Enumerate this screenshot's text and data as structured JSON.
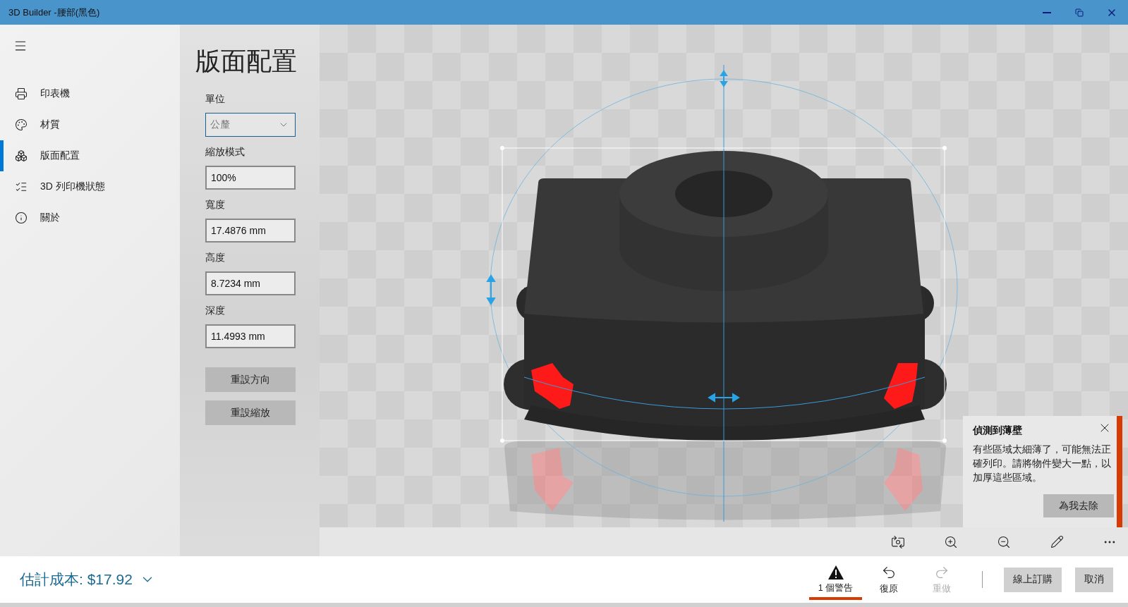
{
  "window": {
    "title": "3D Builder -腰部(黑色)"
  },
  "sidebar": {
    "items": [
      {
        "label": "印表機",
        "selected": false
      },
      {
        "label": "材質",
        "selected": false
      },
      {
        "label": "版面配置",
        "selected": true
      },
      {
        "label": "3D 列印機狀態",
        "selected": false
      },
      {
        "label": "關於",
        "selected": false
      }
    ]
  },
  "panel": {
    "title": "版面配置",
    "fields": [
      {
        "kind": "dropdown",
        "label": "單位",
        "value": "公釐"
      },
      {
        "kind": "input",
        "label": "縮放模式",
        "value": "100%"
      },
      {
        "kind": "input",
        "label": "寬度",
        "value": "17.4876 mm"
      },
      {
        "kind": "input",
        "label": "高度",
        "value": "8.7234 mm"
      },
      {
        "kind": "input",
        "label": "深度",
        "value": "11.4993 mm"
      }
    ],
    "buttons": [
      "重設方向",
      "重設縮放"
    ]
  },
  "notification": {
    "title": "偵測到薄壁",
    "message": "有些區域太細薄了，可能無法正確列印。請將物件變大一點，以加厚這些區域。",
    "button": "為我去除"
  },
  "bottom_bar": {
    "cost": "估計成本: $17.92",
    "actions": [
      {
        "label": "1 個警告",
        "selected": true,
        "disabled": false
      },
      {
        "label": "復原",
        "selected": false,
        "disabled": false
      },
      {
        "label": "重做",
        "selected": false,
        "disabled": true
      }
    ],
    "buttons": [
      "線上訂購",
      "取消"
    ]
  }
}
